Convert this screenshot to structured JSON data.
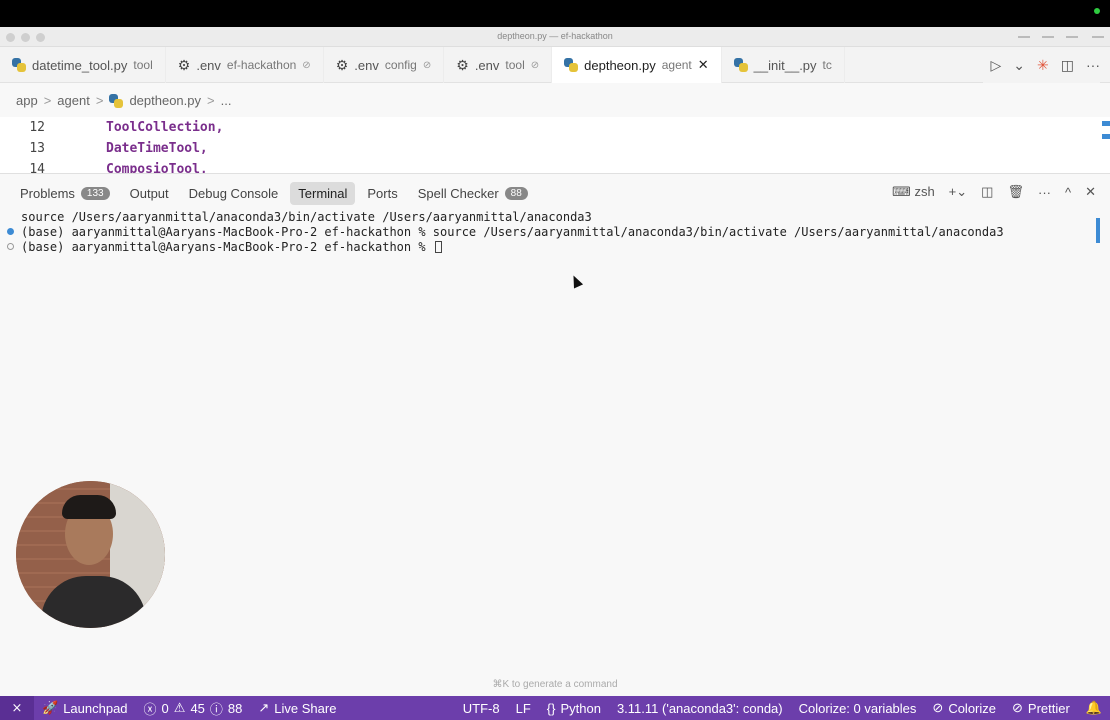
{
  "window": {
    "title": "deptheon.py — ef-hackathon"
  },
  "tabs": [
    {
      "icon": "python-icon",
      "name": "datetime_tool.py",
      "sub": "tool"
    },
    {
      "icon": "gear-icon",
      "name": ".env",
      "sub": "ef-hackathon",
      "mod": "⊘"
    },
    {
      "icon": "gear-icon",
      "name": ".env",
      "sub": "config",
      "mod": "⊘"
    },
    {
      "icon": "gear-icon",
      "name": ".env",
      "sub": "tool",
      "mod": "⊘"
    },
    {
      "icon": "python-icon",
      "name": "deptheon.py",
      "sub": "agent",
      "close": "✕",
      "active": true
    },
    {
      "icon": "python-icon",
      "name": "__init__.py",
      "sub": "tc"
    }
  ],
  "tab_actions": {
    "run": "▷",
    "run_menu": "⌄",
    "split": "◫",
    "more": "···"
  },
  "breadcrumb": {
    "items": [
      "app",
      "agent",
      "deptheon.py",
      "..."
    ],
    "separator": ">"
  },
  "editor": {
    "lines": [
      {
        "number": "12",
        "code": "ToolCollection,"
      },
      {
        "number": "13",
        "code": "DateTimeTool,"
      },
      {
        "number": "14",
        "code": "ComposioTool,"
      }
    ]
  },
  "panel": {
    "tabs": [
      {
        "label": "Problems",
        "badge": "133"
      },
      {
        "label": "Output",
        "badge": ""
      },
      {
        "label": "Debug Console",
        "badge": ""
      },
      {
        "label": "Terminal",
        "badge": "",
        "active": true
      },
      {
        "label": "Ports",
        "badge": ""
      },
      {
        "label": "Spell Checker",
        "badge": "88"
      }
    ],
    "actions": {
      "shell_icon": "⌨",
      "shell": "zsh",
      "add": "+",
      "add_menu": "⌄",
      "split": "◫",
      "trash": "🗑",
      "more": "···",
      "maximize": "^",
      "close": "✕"
    }
  },
  "terminal": {
    "lines": [
      {
        "marker": "none",
        "text": "source /Users/aaryanmittal/anaconda3/bin/activate /Users/aaryanmittal/anaconda3"
      },
      {
        "marker": "blue",
        "text": "(base) aaryanmittal@Aaryans-MacBook-Pro-2 ef-hackathon % source /Users/aaryanmittal/anaconda3/bin/activate /Users/aaryanmittal/anaconda3"
      },
      {
        "marker": "hollow",
        "text": "(base) aaryanmittal@Aaryans-MacBook-Pro-2 ef-hackathon % "
      }
    ],
    "hint": "⌘K to generate a command"
  },
  "statusbar": {
    "remote_icon": "⨯",
    "launchpad": "Launchpad",
    "errors": "0",
    "warnings": "45",
    "infos": "88",
    "live_share": "Live Share",
    "encoding": "UTF-8",
    "eol": "LF",
    "language": "Python",
    "interpreter": "3.11.11 ('anaconda3': conda)",
    "colorize_vars": "Colorize: 0 variables",
    "colorize": "Colorize",
    "prettier": "Prettier",
    "accent": "#6c3eab"
  }
}
